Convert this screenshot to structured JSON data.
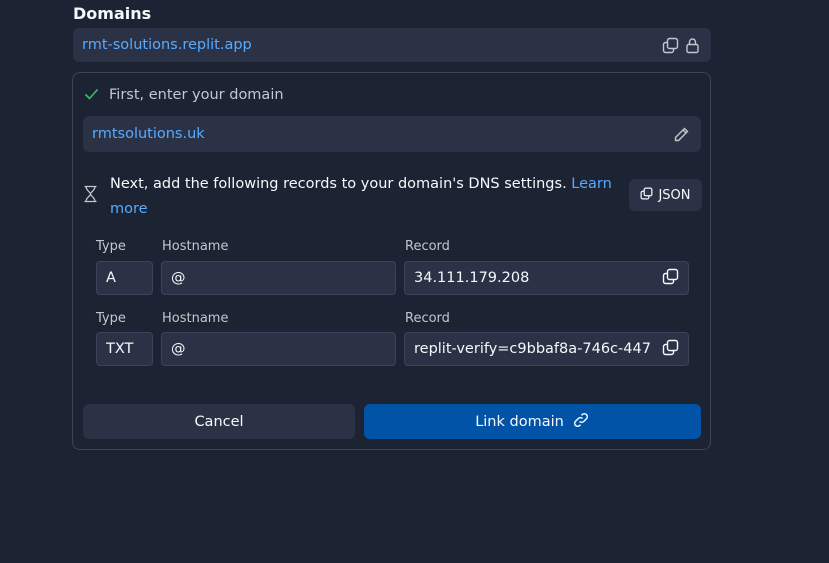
{
  "section": {
    "title": "Domains"
  },
  "current_domain": {
    "value": "rmt-solutions.replit.app",
    "copy_icon": "copy-icon",
    "lock_icon": "lock-icon"
  },
  "step1": {
    "label": "First, enter your domain",
    "status_icon": "check-icon"
  },
  "domain_input": {
    "value": "rmtsolutions.uk",
    "edit_icon": "pencil-icon"
  },
  "step2": {
    "text": "Next, add the following records to your domain's DNS settings.",
    "learn_more": "Learn more",
    "status_icon": "hourglass-icon"
  },
  "json_button": {
    "label": "JSON",
    "icon": "copy-icon"
  },
  "records": [
    {
      "type_label": "Type",
      "hostname_label": "Hostname",
      "record_label": "Record",
      "type": "A",
      "hostname": "@",
      "record": "34.111.179.208"
    },
    {
      "type_label": "Type",
      "hostname_label": "Hostname",
      "record_label": "Record",
      "type": "TXT",
      "hostname": "@",
      "record": "replit-verify=c9bbaf8a-746c-447"
    }
  ],
  "actions": {
    "cancel": "Cancel",
    "link": "Link domain",
    "link_icon": "link-icon"
  },
  "colors": {
    "background": "#1c2333",
    "surface": "#2b3245",
    "accent_link": "#57abff",
    "primary_button": "#0053a6",
    "success": "#3bbf6a"
  }
}
